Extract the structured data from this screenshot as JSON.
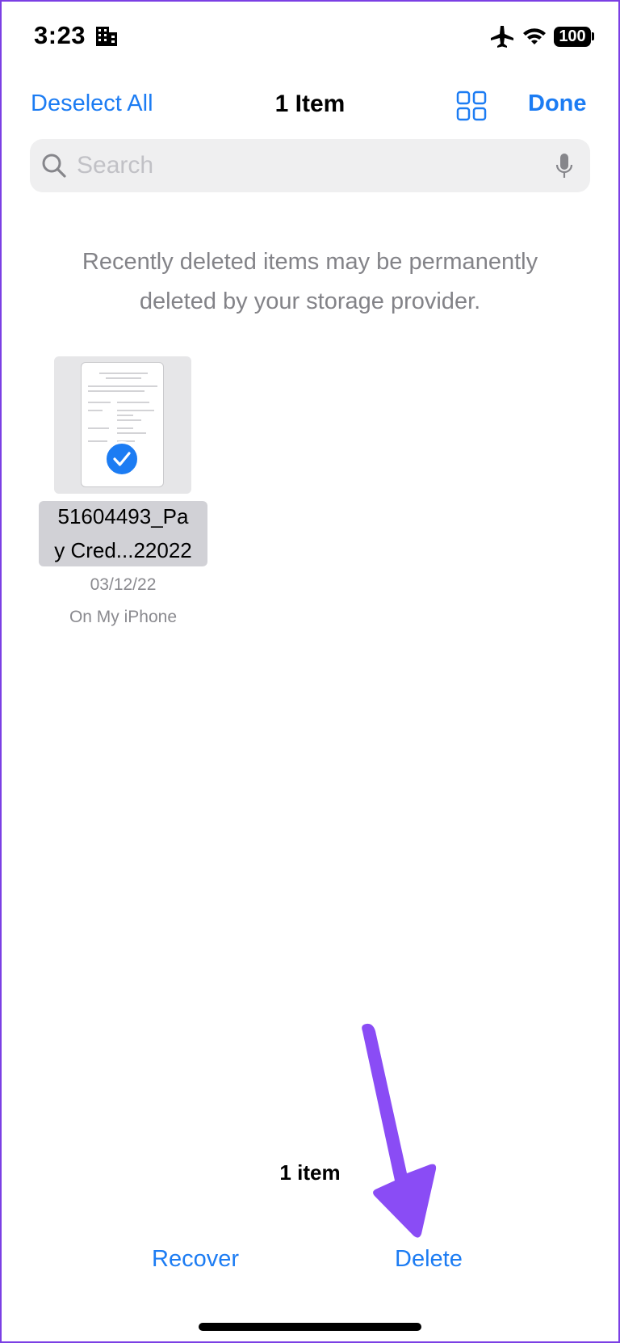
{
  "status_bar": {
    "time": "3:23",
    "battery": "100",
    "icons": [
      "building-icon",
      "airplane-icon",
      "wifi-icon",
      "battery-icon"
    ]
  },
  "nav": {
    "left_button": "Deselect All",
    "title": "1 Item",
    "view_icon": "grid-icon",
    "right_button": "Done"
  },
  "search": {
    "placeholder": "Search",
    "value": ""
  },
  "info_text": "Recently deleted items may be permanently deleted by your storage provider.",
  "files": [
    {
      "name_line1": "51604493_Pa",
      "name_line2": "y Cred...22022",
      "date": "03/12/22",
      "location": "On My iPhone",
      "selected": true
    }
  ],
  "toolbar": {
    "count": "1 item",
    "recover": "Recover",
    "delete": "Delete"
  },
  "colors": {
    "accent": "#1c7cf3",
    "annotation_arrow": "#8a4cf5",
    "frame": "#7b3fe4"
  }
}
